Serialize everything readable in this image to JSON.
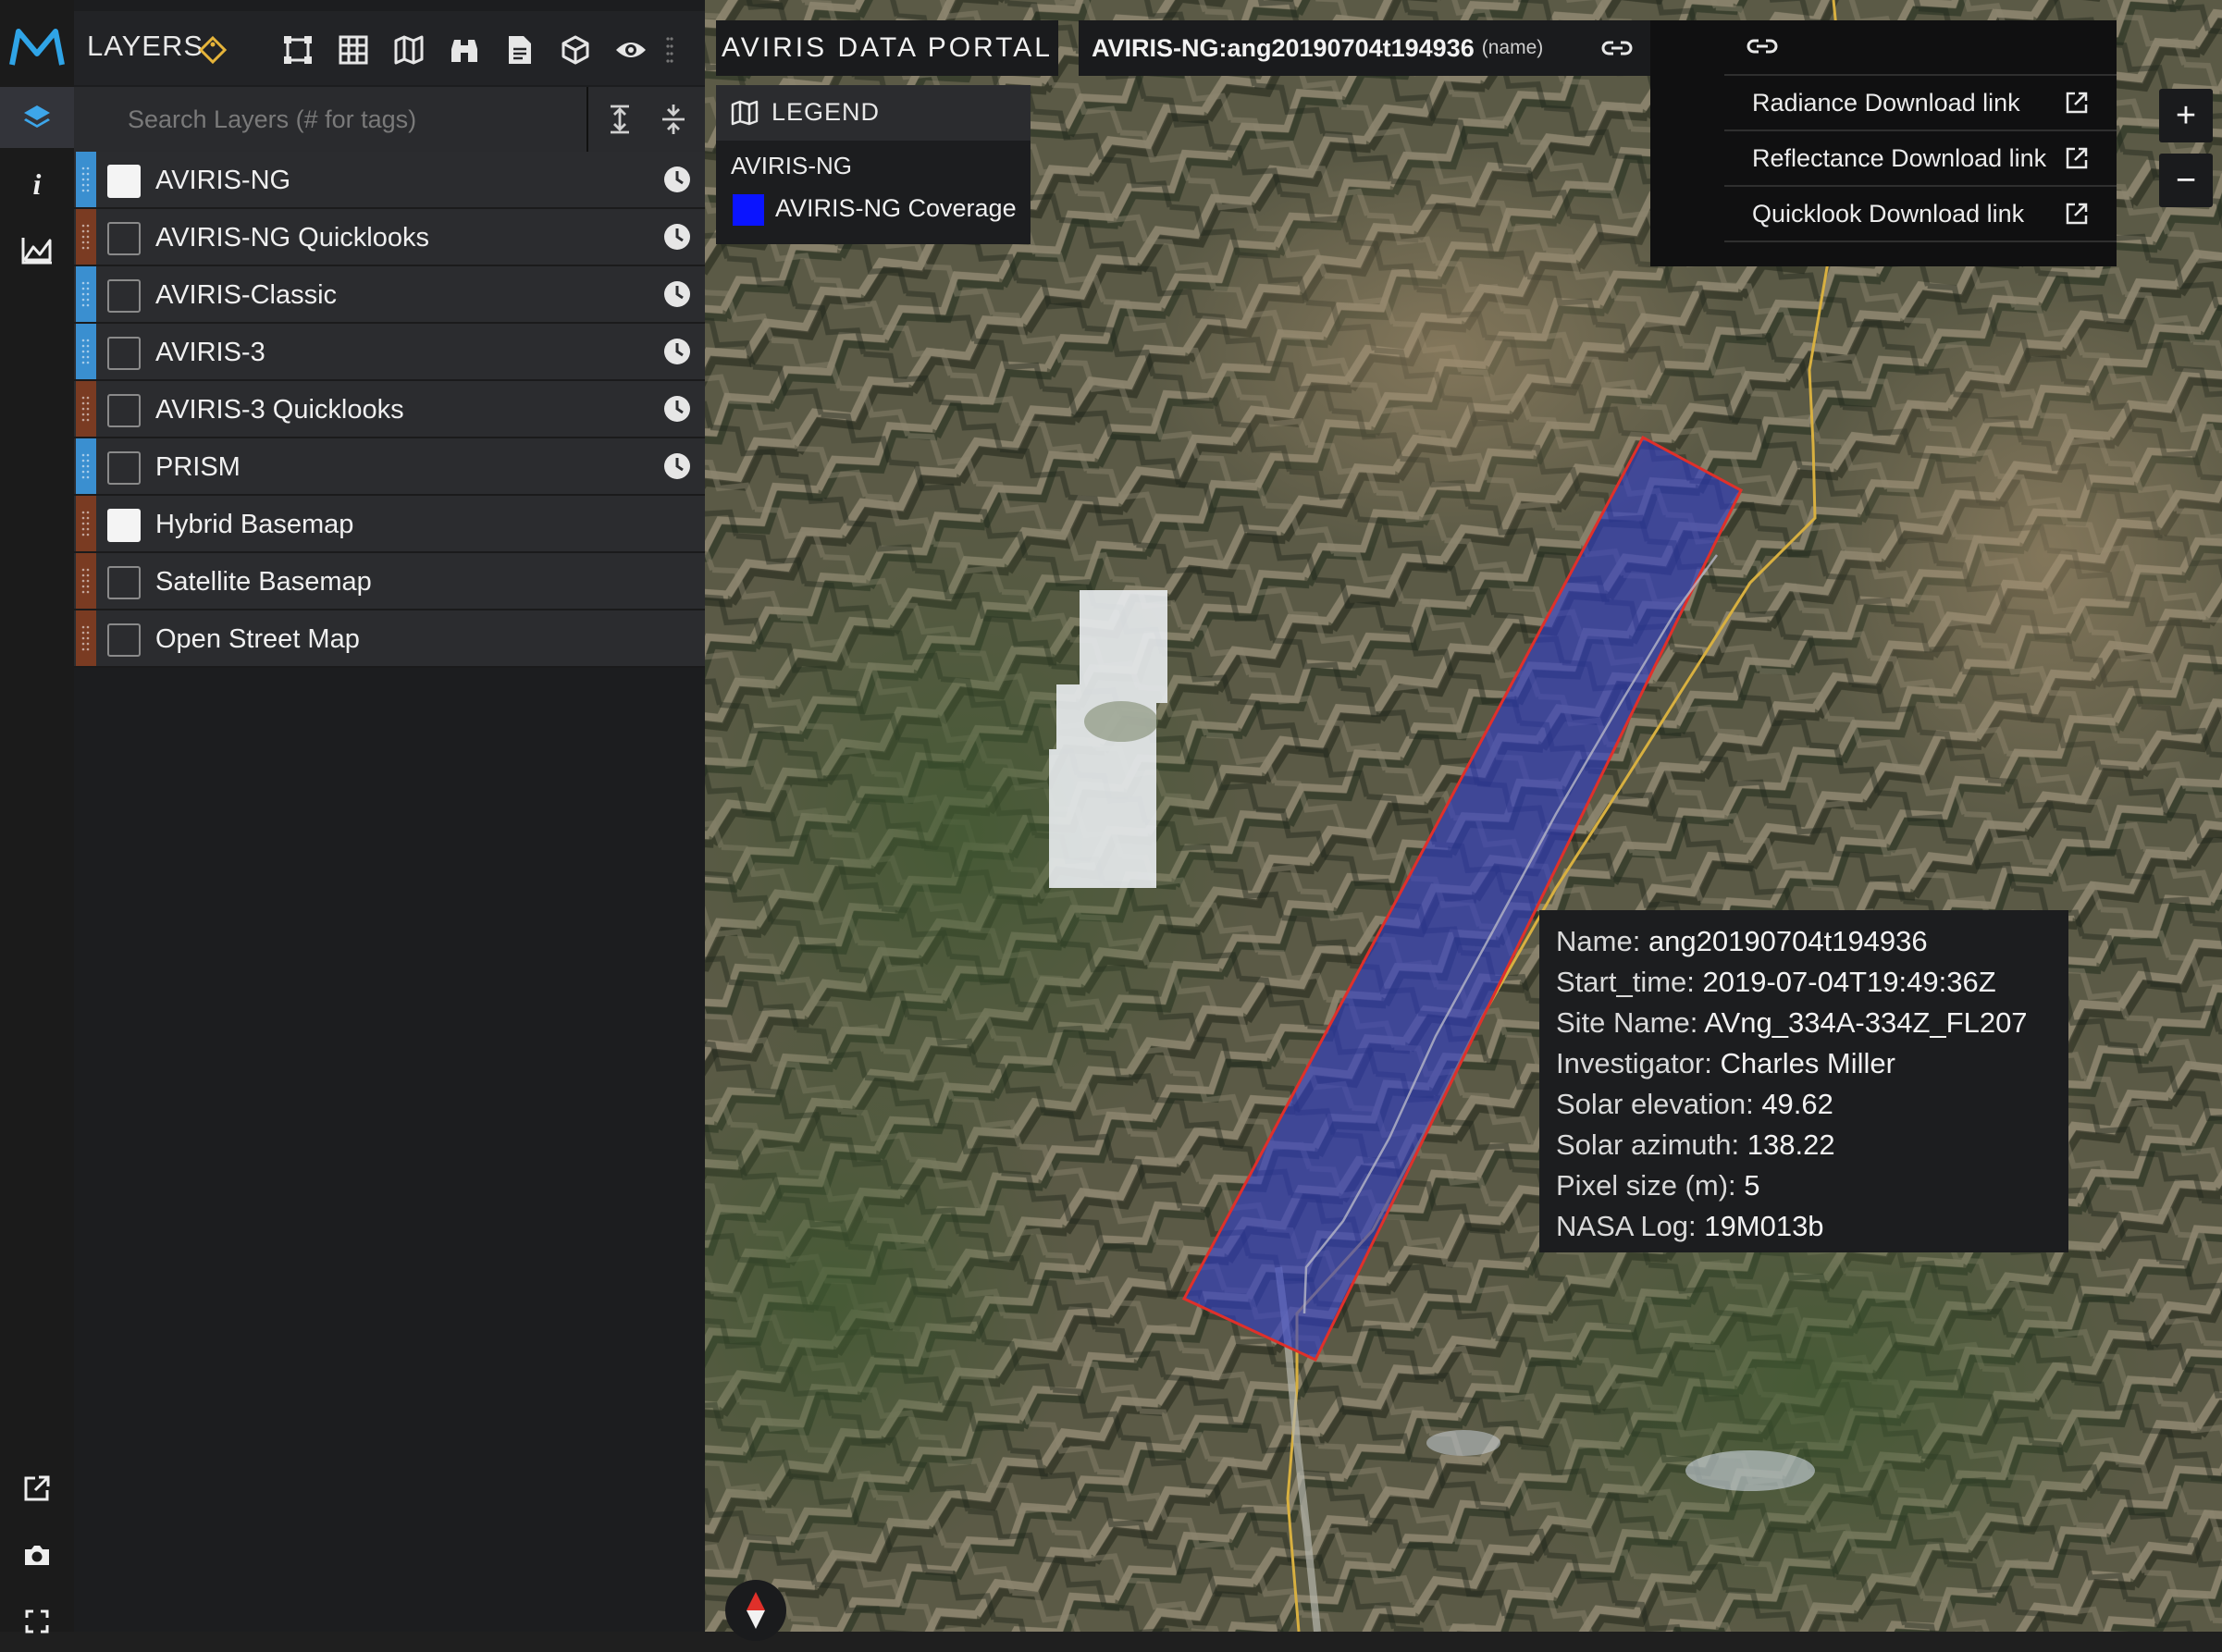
{
  "app": {
    "panel_title": "LAYERS"
  },
  "search": {
    "placeholder": "Search Layers (# for tags)"
  },
  "layers": [
    {
      "name": "AVIRIS-NG",
      "checked": true,
      "handle_color": "#3a8fd0",
      "has_time": true
    },
    {
      "name": "AVIRIS-NG Quicklooks",
      "checked": false,
      "handle_color": "#7a3b22",
      "has_time": true
    },
    {
      "name": "AVIRIS-Classic",
      "checked": false,
      "handle_color": "#3a8fd0",
      "has_time": true
    },
    {
      "name": "AVIRIS-3",
      "checked": false,
      "handle_color": "#3a8fd0",
      "has_time": true
    },
    {
      "name": "AVIRIS-3 Quicklooks",
      "checked": false,
      "handle_color": "#7a3b22",
      "has_time": true
    },
    {
      "name": "PRISM",
      "checked": false,
      "handle_color": "#3a8fd0",
      "has_time": true
    },
    {
      "name": "Hybrid Basemap",
      "checked": true,
      "handle_color": "#7a3b22",
      "has_time": false
    },
    {
      "name": "Satellite Basemap",
      "checked": false,
      "handle_color": "#7a3b22",
      "has_time": false
    },
    {
      "name": "Open Street Map",
      "checked": false,
      "handle_color": "#7a3b22",
      "has_time": false
    }
  ],
  "portal": {
    "title": "AVIRIS DATA PORTAL"
  },
  "feature": {
    "name": "AVIRIS-NG:ang20190704t194936",
    "field": "(name)"
  },
  "legend": {
    "title": "LEGEND",
    "group": "AVIRIS-NG",
    "item_label": "AVIRIS-NG Coverage",
    "swatch_color": "#0a14ff"
  },
  "links": [
    {
      "label": "Radiance Download link"
    },
    {
      "label": "Reflectance Download link"
    },
    {
      "label": "Quicklook Download link"
    }
  ],
  "zoom": {
    "in": "+",
    "out": "−"
  },
  "info": [
    {
      "key": "Name:",
      "value": "ang20190704t194936"
    },
    {
      "key": "Start_time:",
      "value": "2019-07-04T19:49:36Z"
    },
    {
      "key": "Site Name:",
      "value": "AVng_334A-334Z_FL207"
    },
    {
      "key": "Investigator:",
      "value": "Charles Miller"
    },
    {
      "key": "Solar elevation:",
      "value": "49.62"
    },
    {
      "key": "Solar azimuth:",
      "value": "138.22"
    },
    {
      "key": "Pixel size (m):",
      "value": "5"
    },
    {
      "key": "NASA Log:",
      "value": "19M013b"
    }
  ],
  "colors": {
    "accent_blue": "#3a8fd0",
    "accent_brown": "#7a3b22",
    "coverage_fill": "#2e3cc8",
    "coverage_stroke": "#e0302a",
    "road": "#d8b040"
  }
}
